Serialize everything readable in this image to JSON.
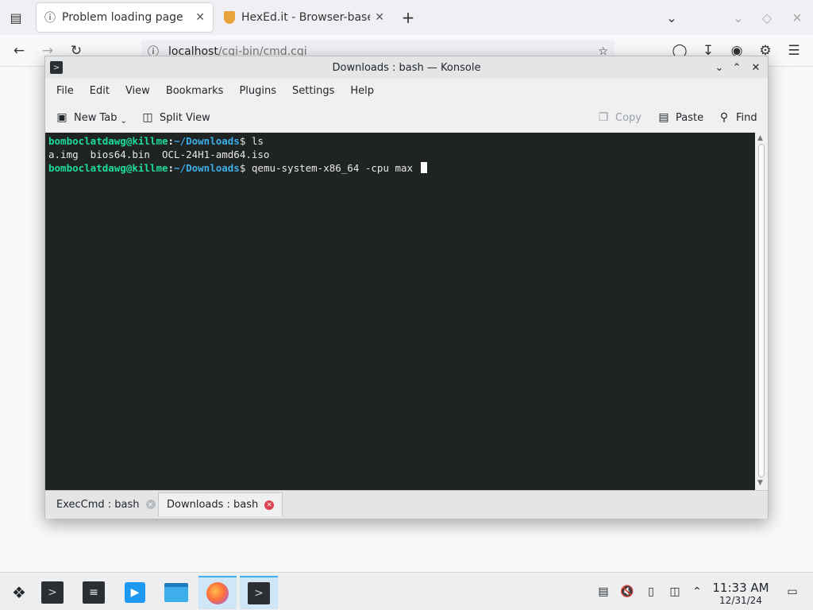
{
  "browser": {
    "tabs": [
      {
        "title": "Problem loading page",
        "icon": "info-icon"
      },
      {
        "title": "HexEd.it - Browser-based",
        "icon": "hexedit-shield-icon"
      }
    ],
    "url_host": "localhost",
    "url_path": "/cgi-bin/cmd.cgi"
  },
  "konsole": {
    "title": "Downloads : bash — Konsole",
    "menu": [
      "File",
      "Edit",
      "View",
      "Bookmarks",
      "Plugins",
      "Settings",
      "Help"
    ],
    "toolbar": {
      "new_tab": "New Tab",
      "split_view": "Split View",
      "copy": "Copy",
      "paste": "Paste",
      "find": "Find"
    },
    "terminal": {
      "lines": [
        {
          "user": "bomboclatdawg@killme",
          "colon": ":",
          "path": "~/Downloads",
          "cmd": "$ ls"
        },
        {
          "output": "a.img  bios64.bin  OCL-24H1-amd64.iso"
        },
        {
          "user": "bomboclatdawg@killme",
          "colon": ":",
          "path": "~/Downloads",
          "cmd": "$ qemu-system-x86_64 -cpu max "
        }
      ]
    },
    "tabs": [
      {
        "label": "ExecCmd : bash",
        "active": false
      },
      {
        "label": "Downloads : bash",
        "active": true
      }
    ],
    "colors": {
      "prompt_user": "#1cdc9a",
      "prompt_path": "#3daee9",
      "background": "#1f2322",
      "close_active": "#da4453"
    }
  },
  "taskbar": {
    "clock_time": "11:33 AM",
    "clock_date": "12/31/24"
  }
}
